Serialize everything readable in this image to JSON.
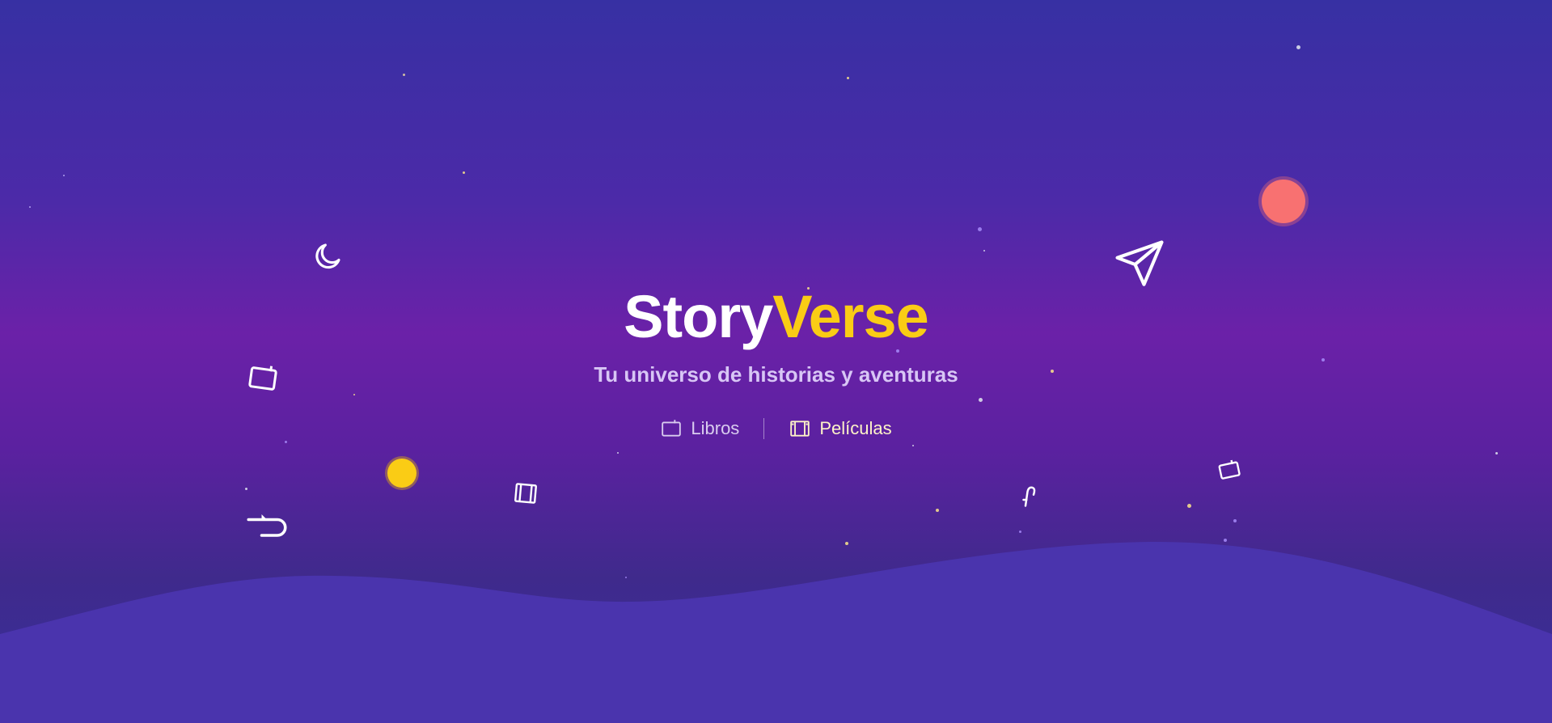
{
  "brand": {
    "title_part1": "Story",
    "title_part2": "Verse"
  },
  "tagline": "Tu universo de historias y aventuras",
  "nav": {
    "items": [
      {
        "label": "Libros",
        "icon": "book-icon",
        "active": false
      },
      {
        "label": "Películas",
        "icon": "film-icon",
        "active": true
      }
    ]
  },
  "decorations": {
    "floating_icons": [
      "moon-icon",
      "book-icon",
      "film-icon",
      "paper-plane-icon",
      "music-note-icon",
      "book-icon",
      "return-arrow-icon"
    ],
    "planets": [
      "coral",
      "yellow"
    ]
  },
  "colors": {
    "accent": "#facc15",
    "background_top": "#3730a3",
    "background_mid": "#6b21a8",
    "wave": "#4a34ad",
    "planet_coral": "#f87171",
    "planet_yellow": "#facc15"
  }
}
